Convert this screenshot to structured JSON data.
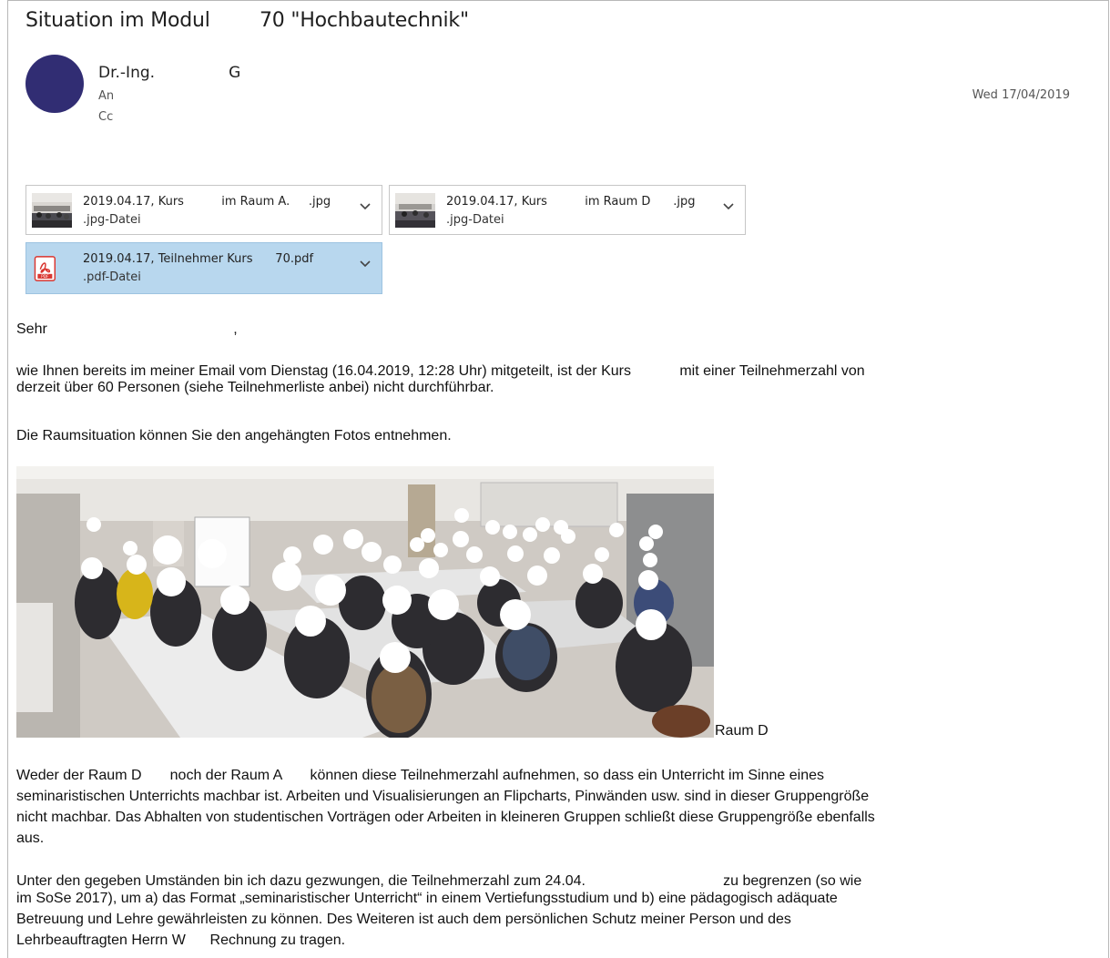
{
  "email": {
    "subject": "Situation im Modul        70 \"Hochbautechnik\"",
    "sender": "Dr.-Ing.               G",
    "to_label": "An",
    "cc_label": "Cc",
    "date": "Wed 17/04/2019",
    "avatar_color": "#312d73"
  },
  "attachments": [
    {
      "name": "2019.04.17, Kurs          im Raum A.     .jpg",
      "type": ".jpg-Datei",
      "icon": "photo-thumbnail"
    },
    {
      "name": "2019.04.17, Kurs          im Raum D      .jpg",
      "type": ".jpg-Datei",
      "icon": "photo-thumbnail"
    },
    {
      "name": "2019.04.17, Teilnehmer Kurs      70.pdf",
      "type": ".pdf-Datei",
      "icon": "pdf-icon",
      "selected": true
    }
  ],
  "body": {
    "greeting": "Sehr                                              ,",
    "p1_line1": "wie Ihnen bereits im meiner Email vom Dienstag (16.04.2019, 12:28 Uhr) mitgeteilt, ist der Kurs            mit einer Teilnehmerzahl von",
    "p1_line2": "derzeit über 60 Personen (siehe Teilnehmerliste anbei) nicht durchführbar.",
    "p2": "Die Raumsituation können Sie den angehängten Fotos entnehmen.",
    "photo_caption": "Raum D",
    "p3_line1": "Weder der Raum D       noch der Raum A       können diese Teilnehmerzahl aufnehmen, so dass ein Unterricht im Sinne eines",
    "p3_line2": "seminaristischen Unterrichts machbar ist. Arbeiten und Visualisierungen an Flipcharts, Pinwänden usw. sind in dieser Gruppengröße",
    "p3_line3": "nicht machbar. Das Abhalten von studentischen Vorträgen oder Arbeiten in kleineren Gruppen schließt diese Gruppengröße ebenfalls",
    "p3_line4": "aus.",
    "p4_line1": "Unter den gegeben Umständen bin ich dazu gezwungen, die Teilnehmerzahl zum 24.04.                                  zu begrenzen (so wie",
    "p4_line2": "im SoSe 2017), um a) das Format „seminaristischer Unterricht“ in einem Vertiefungsstudium und b) eine pädagogisch adäquate",
    "p4_line3": "Betreuung und Lehre gewährleisten zu können. Des Weiteren ist auch dem persönlichen Schutz meiner Person und des",
    "p4_line4": "Lehrbeauftragten Herrn W      Rechnung zu tragen."
  }
}
